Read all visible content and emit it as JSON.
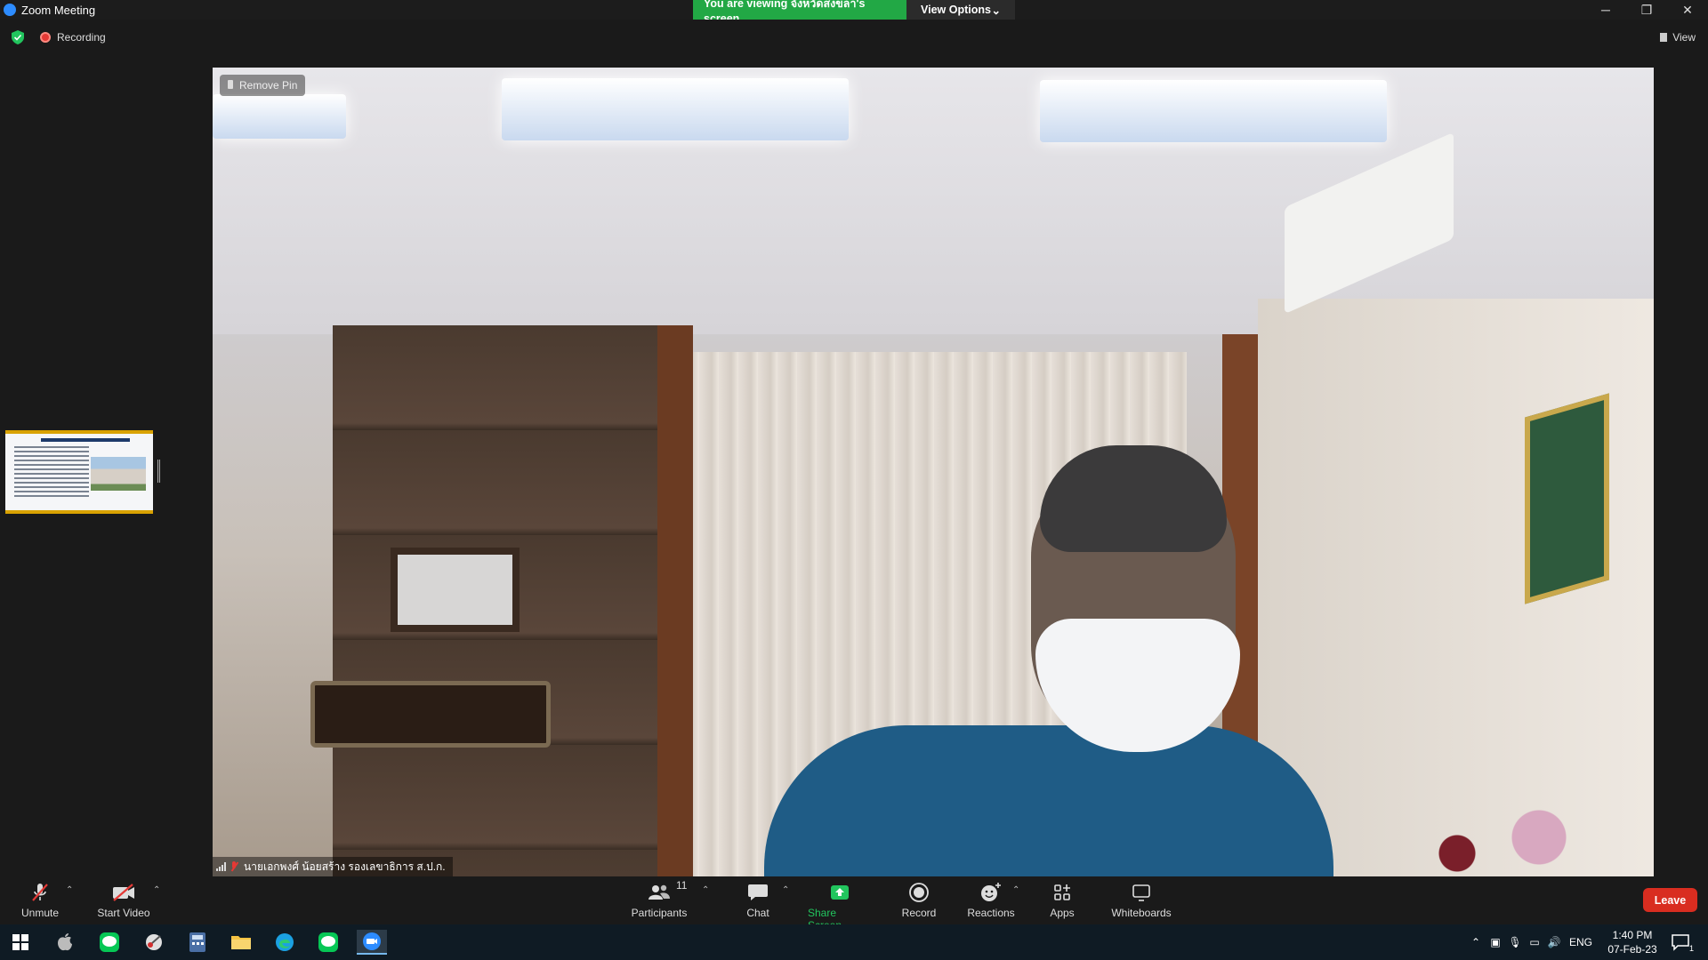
{
  "window": {
    "title": "Zoom Meeting"
  },
  "share_banner": {
    "text": "You are viewing จังหวัดสงขลา's screen",
    "view_options": "View Options"
  },
  "status": {
    "recording": "Recording",
    "view": "View"
  },
  "video": {
    "remove_pin": "Remove Pin",
    "participant_name": "นายเอกพงศ์ น้อยสร้าง รองเลขาธิการ ส.ป.ก."
  },
  "toolbar": {
    "unmute": "Unmute",
    "start_video": "Start Video",
    "participants": "Participants",
    "participants_count": "11",
    "chat": "Chat",
    "share_screen": "Share Screen",
    "record": "Record",
    "reactions": "Reactions",
    "apps": "Apps",
    "whiteboards": "Whiteboards",
    "leave": "Leave"
  },
  "taskbar": {
    "language": "ENG",
    "time": "1:40 PM",
    "date": "07-Feb-23",
    "notifications": "1"
  },
  "colors": {
    "share_green": "#22a845",
    "leave_red": "#d92d20",
    "accent_blue": "#2d8cff"
  }
}
